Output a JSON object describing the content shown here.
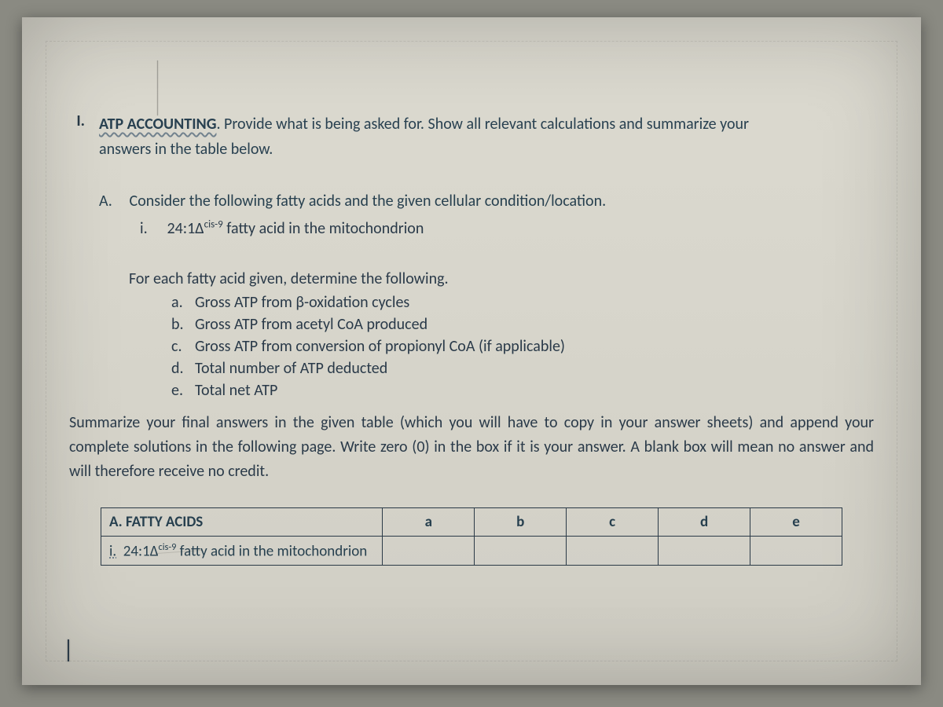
{
  "outline": {
    "roman": "I.",
    "heading_underlined": "ATP ACCOUNTING",
    "heading_after": ". Provide what is being asked for. Show all relevant calculations and summarize your",
    "heading_line2": "answers in the table below.",
    "A_label": "A.",
    "A_text": "Consider the following fatty acids and the given cellular condition/location.",
    "A_i_label": "i.",
    "A_i_text_before": "24:1Δ",
    "A_i_sup": "cis-9",
    "A_i_text_after": " fatty acid in the mitochondrion",
    "foreach": "For each fatty acid given, determine the following.",
    "items": [
      {
        "l": "a.",
        "t": "Gross ATP from β-oxidation cycles"
      },
      {
        "l": "b.",
        "t": "Gross ATP from acetyl CoA produced"
      },
      {
        "l": "c.",
        "t": "Gross ATP from conversion of propionyl CoA (if applicable)"
      },
      {
        "l": "d.",
        "t": "Total number of ATP deducted"
      },
      {
        "l": "e.",
        "t": "Total net ATP"
      }
    ],
    "summary": "Summarize your final answers in the given table (which you will have to copy in your answer sheets) and append your complete solutions in the following page. Write zero (0) in the box if it is your answer. A blank box will mean no answer and will therefore receive no credit."
  },
  "table": {
    "header": "A. FATTY ACIDS",
    "cols": [
      "a",
      "b",
      "c",
      "d",
      "e"
    ],
    "row_i_label": "i.",
    "row_i_before": "24:1Δ",
    "row_i_sup": "cis-9",
    "row_i_after": " fatty acid in the mitochondrion",
    "cells": [
      "",
      "",
      "",
      "",
      ""
    ]
  }
}
